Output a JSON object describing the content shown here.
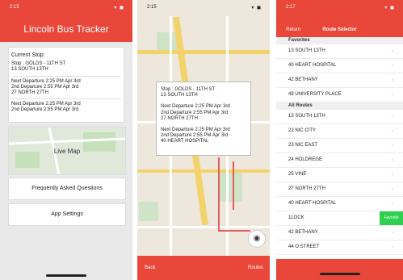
{
  "phone1": {
    "status": {
      "time": "2:15",
      "icons": "▾ ◼"
    },
    "app_title": "Lincoln Bus Tracker",
    "current_stop_label": "Current Stop:",
    "stop_name": "Stop : GOLDS - 11TH ST",
    "stop_route": "13 SOUTH 13TH",
    "departures": [
      {
        "next": "Next Departure   2:25 PM Apr  3rd",
        "second": "2nd Departure   2:55 PM Apr  3rd",
        "route": "27 NORTH 27TH"
      },
      {
        "next": "Next Departure   2:25 PM Apr  3rd",
        "second": "2nd Departure   2:55 PM Apr  3rd",
        "route": ""
      }
    ],
    "live_map_label": "Live Map",
    "faq_label": "Frequently Asked Questions",
    "settings_label": "App Settings"
  },
  "phone2": {
    "status": {
      "time": "2:15",
      "icons": "▾ ◼"
    },
    "popup": {
      "stop_name": "Stop : GOLDS - 11TH ST",
      "stop_route": "13 SOUTH 13TH",
      "departures": [
        {
          "next": "Next Departure   2:25 PM Apr  3rd",
          "second": "2nd Departure   2:55 PM Apr  3rd",
          "route": "27 NORTH 27TH"
        },
        {
          "next": "Next Departure   2:25 PM Apr  3rd",
          "second": "2nd Departure   2:55 PM Apr  3rd",
          "route": "40 HEART HOSPITAL"
        }
      ]
    },
    "back_label": "Back",
    "routes_label": "Routes",
    "locate_icon": "◉"
  },
  "phone3": {
    "status": {
      "time": "2:17",
      "icons": "▾ ◼"
    },
    "return_label": "Return",
    "title": "Route Selector",
    "favorites_header": "Favorites",
    "favorites": [
      "13 SOUTH 13TH",
      "40 HEART HOSPITAL",
      "42 BETHANY",
      "49 UNIVERSITY PLACE"
    ],
    "all_routes_header": "All Routes",
    "all_routes": [
      "13 SOUTH 13TH",
      "22 NIC CITY",
      "23 NIC EAST",
      "24 HOLDREGE",
      "25 VINE",
      "27 NORTH 27TH",
      "40 HEART HOSPITAL",
      "1LOCK",
      "42 BETHANY",
      "44 O STREET"
    ],
    "swipe_action_label": "Favorite"
  }
}
